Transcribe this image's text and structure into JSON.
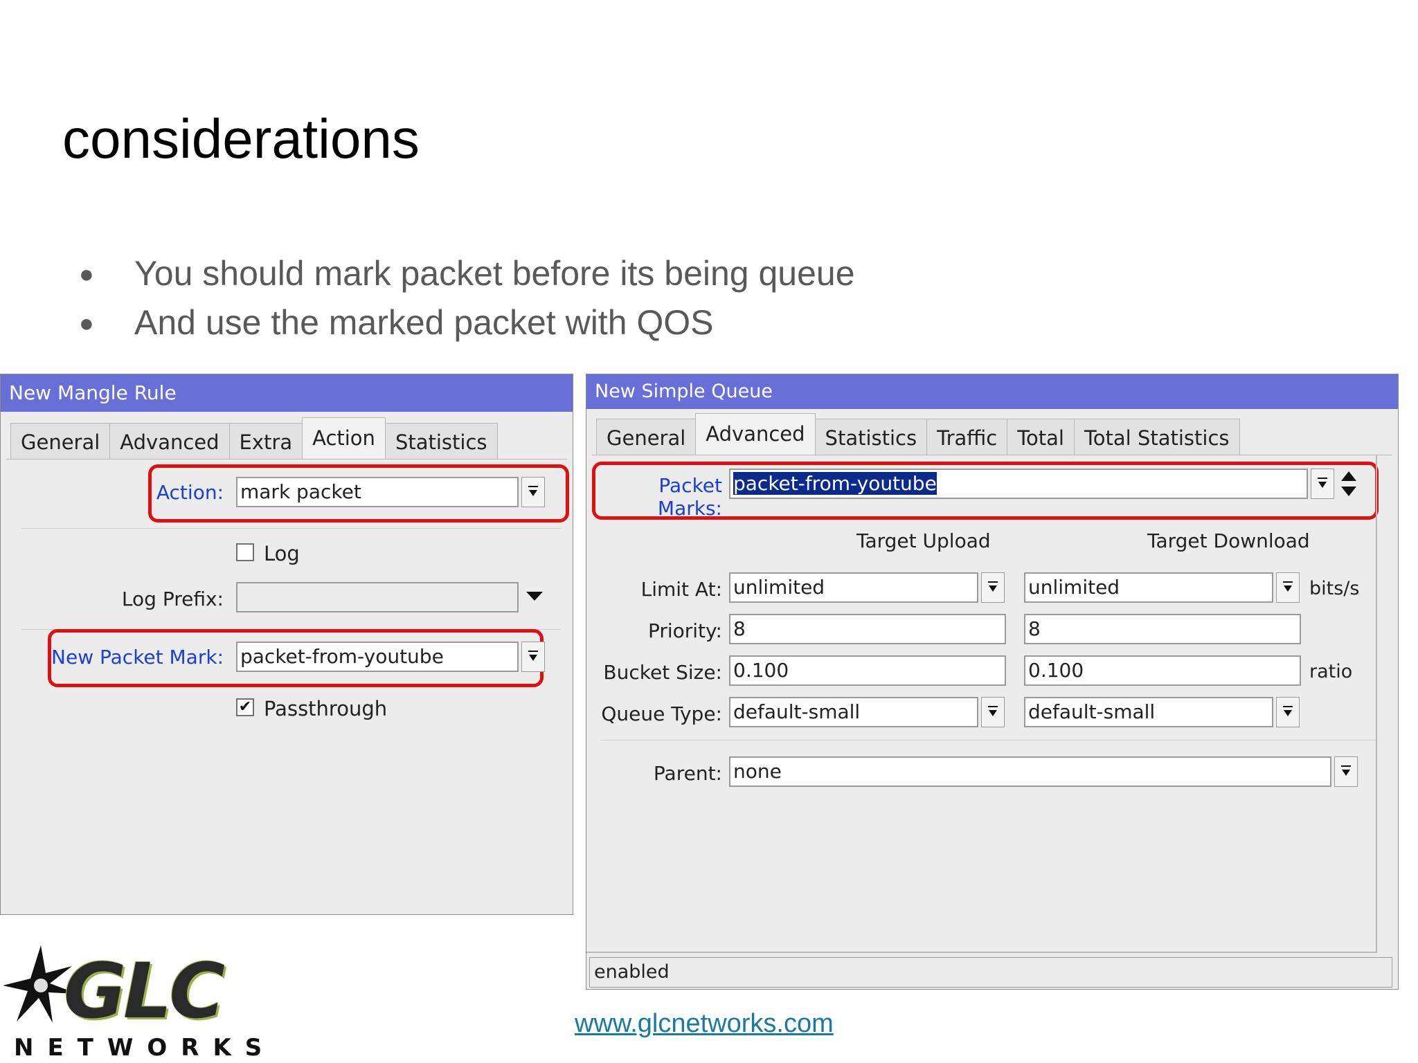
{
  "slide": {
    "title": "considerations",
    "bullets": [
      "You should mark packet before its being queue",
      "And use the marked packet with QOS"
    ],
    "footer_link": "www.glcnetworks.com",
    "logo_text": "GLC",
    "logo_sub": "NETWORKS"
  },
  "mangle": {
    "title": "New Mangle Rule",
    "tabs": [
      "General",
      "Advanced",
      "Extra",
      "Action",
      "Statistics"
    ],
    "active_tab": "Action",
    "action_label": "Action:",
    "action_value": "mark packet",
    "log_label": "Log",
    "log_checked": false,
    "log_prefix_label": "Log Prefix:",
    "log_prefix_value": "",
    "new_packet_mark_label": "New Packet Mark:",
    "new_packet_mark_value": "packet-from-youtube",
    "passthrough_label": "Passthrough",
    "passthrough_checked": true
  },
  "queue": {
    "title": "New Simple Queue",
    "tabs": [
      "General",
      "Advanced",
      "Statistics",
      "Traffic",
      "Total",
      "Total Statistics"
    ],
    "active_tab": "Advanced",
    "packet_marks_label": "Packet Marks:",
    "packet_marks_value": "packet-from-youtube",
    "target_upload_header": "Target Upload",
    "target_download_header": "Target Download",
    "limit_at_label": "Limit At:",
    "limit_at_upload": "unlimited",
    "limit_at_download": "unlimited",
    "limit_unit": "bits/s",
    "priority_label": "Priority:",
    "priority_upload": "8",
    "priority_download": "8",
    "bucket_size_label": "Bucket Size:",
    "bucket_upload": "0.100",
    "bucket_download": "0.100",
    "bucket_unit": "ratio",
    "queue_type_label": "Queue Type:",
    "queue_type_upload": "default-small",
    "queue_type_download": "default-small",
    "parent_label": "Parent:",
    "parent_value": "none",
    "status": "enabled"
  },
  "colors": {
    "titlebar": "#6870d8",
    "highlight": "#e01010",
    "label_blue": "#1a3fd8",
    "link": "#1a7aa0"
  }
}
